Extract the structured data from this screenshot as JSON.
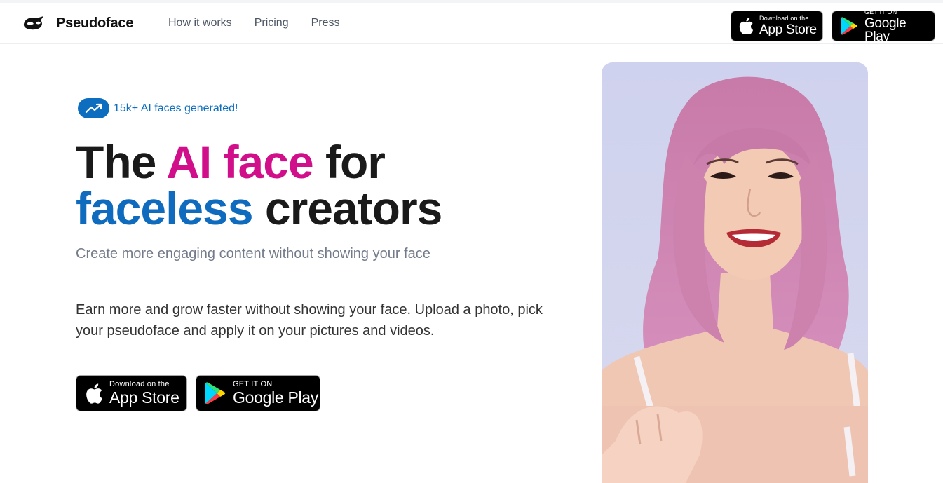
{
  "header": {
    "brand": "Pseudoface",
    "nav": [
      "How it works",
      "Pricing",
      "Press"
    ],
    "app_store": {
      "small": "Download on the",
      "big": "App Store"
    },
    "google_play": {
      "small": "GET IT ON",
      "big": "Google Play"
    }
  },
  "hero": {
    "badge_text": "15k+ AI faces generated!",
    "headline": {
      "part1": "The ",
      "highlight1": "AI face",
      "part2": " for",
      "highlight2": "faceless",
      "part3": " creators"
    },
    "subtitle": "Create more engaging content without showing your face",
    "body": "Earn more and grow faster without showing your face. Upload a photo, pick your pseudoface and apply it on your pictures and videos.",
    "app_store": {
      "small": "Download on the",
      "big": "App Store"
    },
    "google_play": {
      "small": "GET IT ON",
      "big": "Google Play"
    }
  },
  "colors": {
    "accent_pink": "#d20f8a",
    "accent_blue": "#0f6bbd",
    "badge_blue": "#0d6ebf"
  },
  "icons": [
    "pseudoface-logo-icon",
    "trend-up-icon",
    "apple-icon",
    "google-play-icon"
  ]
}
